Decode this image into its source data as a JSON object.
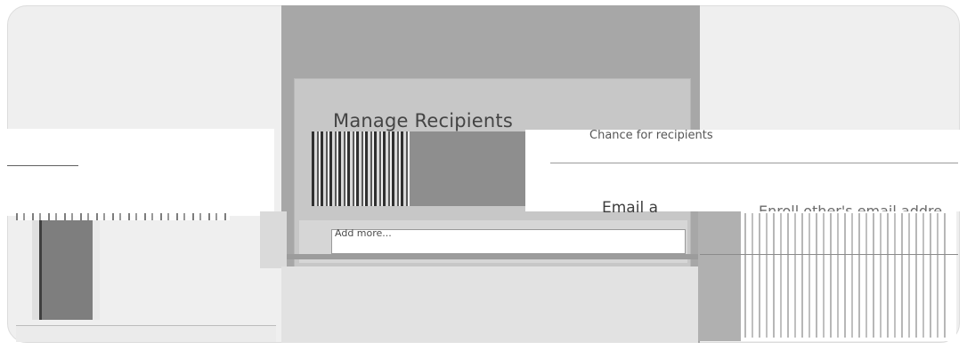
{
  "dialog": {
    "title": "Manage Recipients"
  },
  "fields": {
    "email_label": "Email a",
    "email_hint": "Enroll other's email addre"
  },
  "email_input": {
    "placeholder": "Add more..."
  },
  "strip_text": "Chance for recipients"
}
